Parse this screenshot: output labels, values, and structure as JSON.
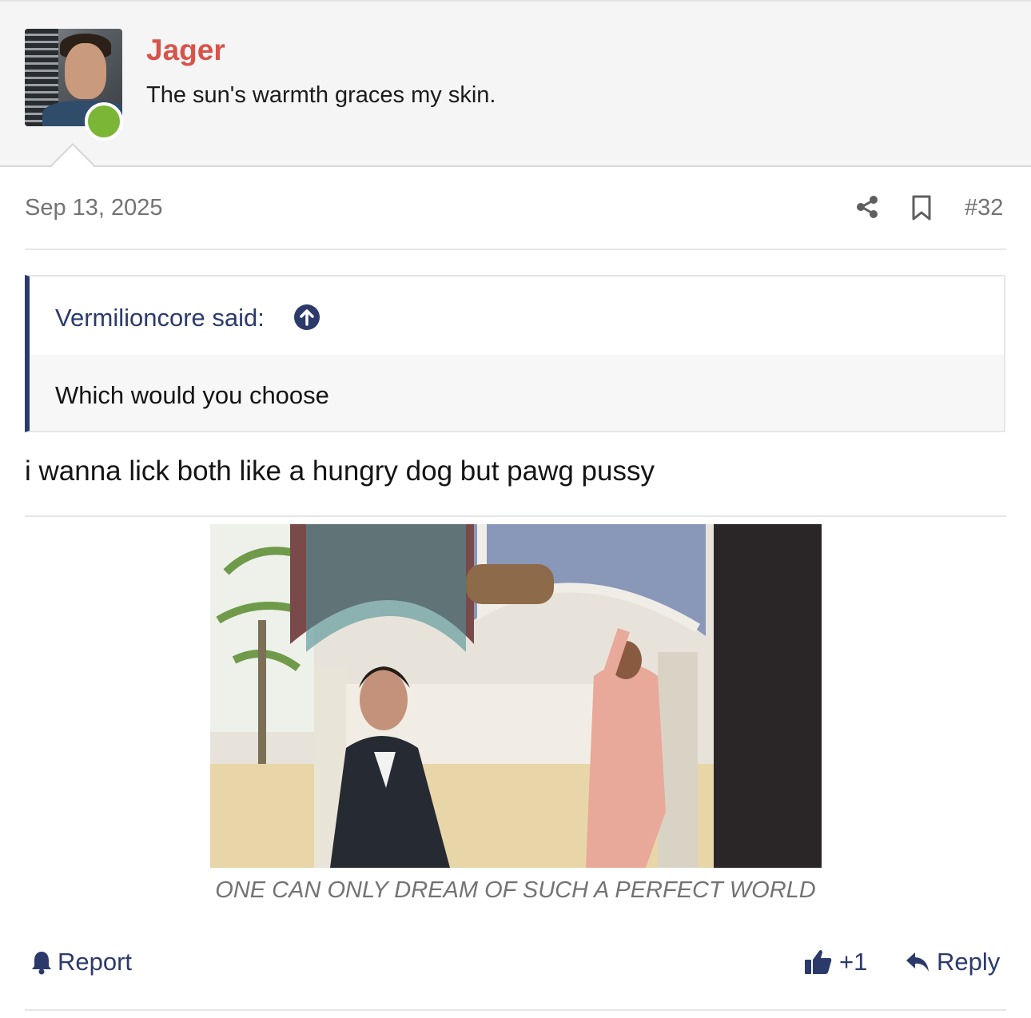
{
  "post": {
    "author": "Jager",
    "user_title": "The sun's warmth graces my skin.",
    "date": "Sep 13, 2025",
    "number": "#32",
    "quote": {
      "author_label": "Vermilioncore said:",
      "text": "Which would you choose"
    },
    "body_text": "i wanna lick both like a hungry dog but pawg pussy",
    "image_caption": "ONE CAN ONLY DREAM OF SUCH A PERFECT WORLD"
  },
  "actions": {
    "report_label": "Report",
    "like_label": "+1",
    "reply_label": "Reply"
  },
  "icons": {
    "share": "share-icon",
    "bookmark": "bookmark-icon",
    "quote_jump": "arrow-up-circle-icon",
    "report": "bell-icon",
    "like": "thumbs-up-icon",
    "reply": "reply-arrow-icon"
  },
  "colors": {
    "username": "#d9534a",
    "accent": "#2b3a6b",
    "online": "#7cb637",
    "muted": "#737373"
  }
}
